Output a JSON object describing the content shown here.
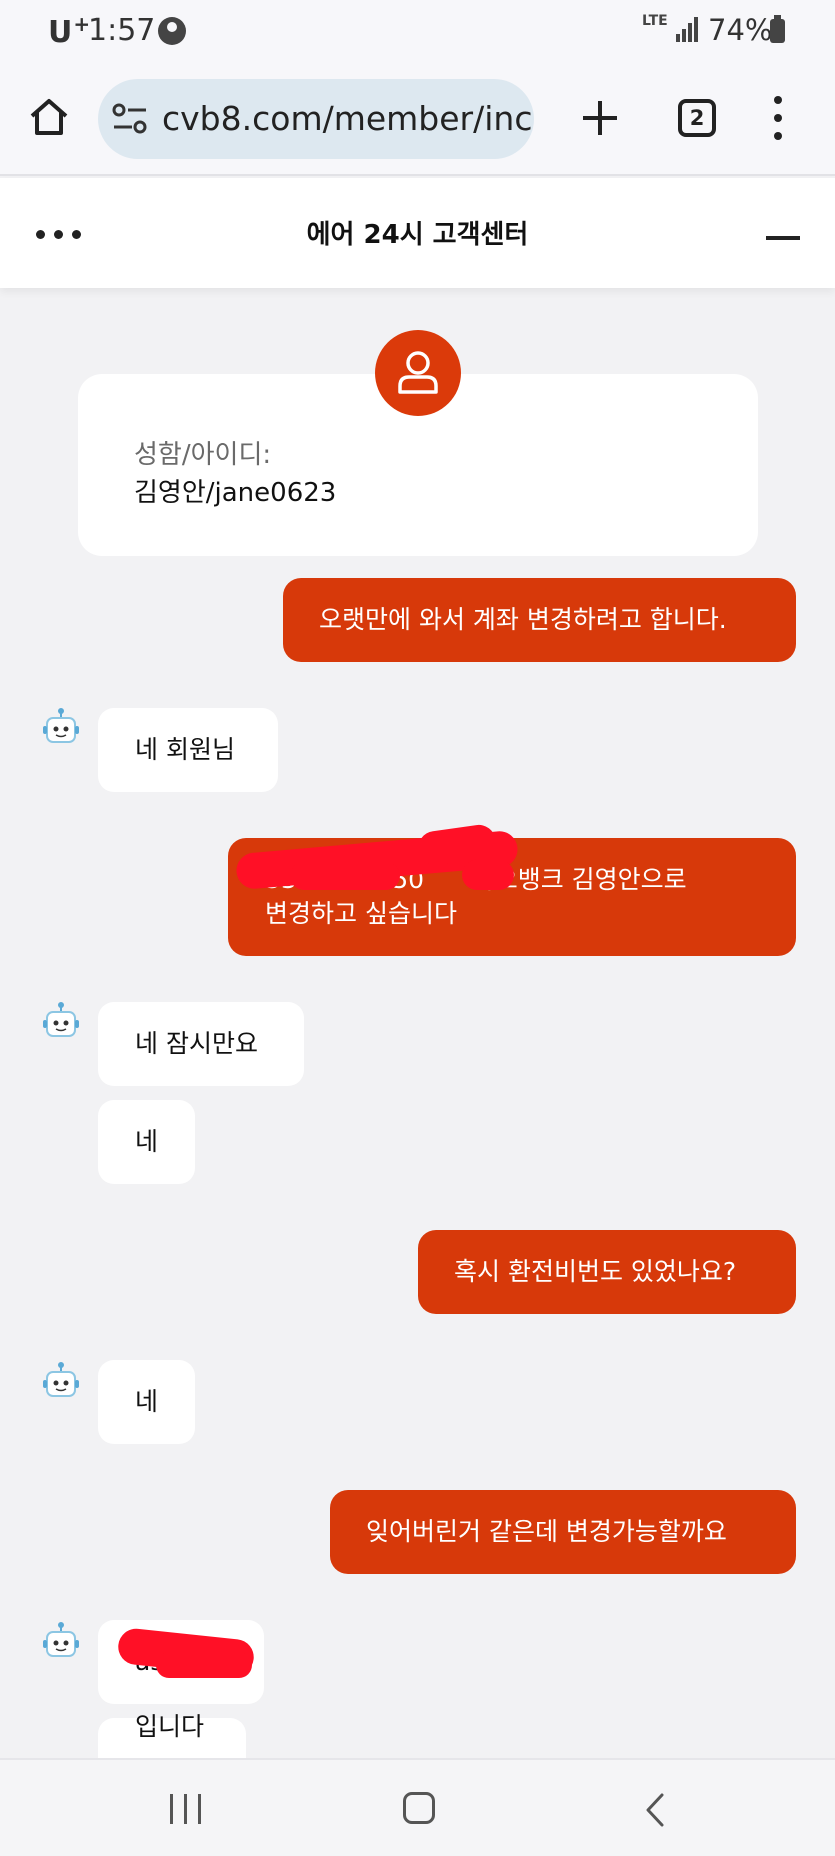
{
  "status_bar": {
    "carrier": "U",
    "carrier_sup": "+",
    "time": "1:57",
    "network": "LTE",
    "battery": "74%"
  },
  "browser": {
    "url": "cvb8.com/member/inc",
    "tab_count": "2"
  },
  "chat": {
    "title": "에어 24시 고객센터",
    "user_info": {
      "label": "성함/아이디:",
      "value": "김영안/jane0623"
    },
    "messages": [
      {
        "from": "user",
        "text": "오랫만에 와서 계좌 변경하려고 합니다."
      },
      {
        "from": "bot",
        "text": "네 회원님"
      },
      {
        "from": "user",
        "line1": "33        7650      카오뱅크 김영안으로",
        "line2": "변경하고 싶습니다"
      },
      {
        "from": "bot",
        "text": "네 잠시만요"
      },
      {
        "from": "bot",
        "text": "네"
      },
      {
        "from": "user",
        "text": "혹시 환전비번도 있었나요?"
      },
      {
        "from": "bot",
        "text": "네"
      },
      {
        "from": "user",
        "text": "잊어버린거 같은데 변경가능할까요"
      },
      {
        "from": "bot",
        "text": "as"
      },
      {
        "from": "bot",
        "text": "입니다"
      }
    ]
  },
  "colors": {
    "accent": "#d7390a",
    "avatar": "#db3a0a",
    "redaction": "#ff1026"
  }
}
